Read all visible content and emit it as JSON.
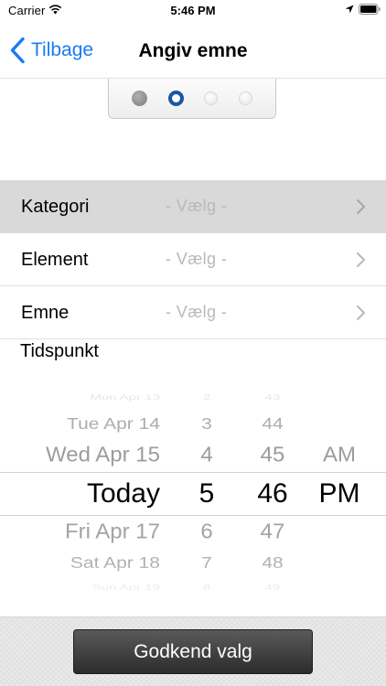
{
  "status_bar": {
    "carrier": "Carrier",
    "time": "5:46 PM"
  },
  "nav": {
    "back_label": "Tilbage",
    "title": "Angiv emne"
  },
  "steps": {
    "total": 4,
    "completed": 1,
    "current": 2,
    "accent_color": "#1657a8"
  },
  "form": {
    "rows": [
      {
        "label": "Kategori",
        "value": "- Vælg -",
        "selected": true
      },
      {
        "label": "Element",
        "value": "- Vælg -",
        "selected": false
      },
      {
        "label": "Emne",
        "value": "- Vælg -",
        "selected": false
      }
    ]
  },
  "time_section": {
    "label": "Tidspunkt"
  },
  "picker": {
    "selected_index": 3,
    "days": [
      "Mon Apr 13",
      "Tue Apr 14",
      "Wed Apr 15",
      "Today",
      "Fri Apr 17",
      "Sat Apr 18",
      "Sun Apr 19"
    ],
    "hours": [
      "2",
      "3",
      "4",
      "5",
      "6",
      "7",
      "8"
    ],
    "minutes": [
      "43",
      "44",
      "45",
      "46",
      "47",
      "48",
      "49"
    ],
    "ampm": [
      "AM",
      "PM"
    ],
    "selected_ampm_index": 1
  },
  "bottom": {
    "confirm_label": "Godkend valg"
  },
  "colors": {
    "ios_blue": "#1a7bf2",
    "placeholder_gray": "#b8b8bd"
  }
}
